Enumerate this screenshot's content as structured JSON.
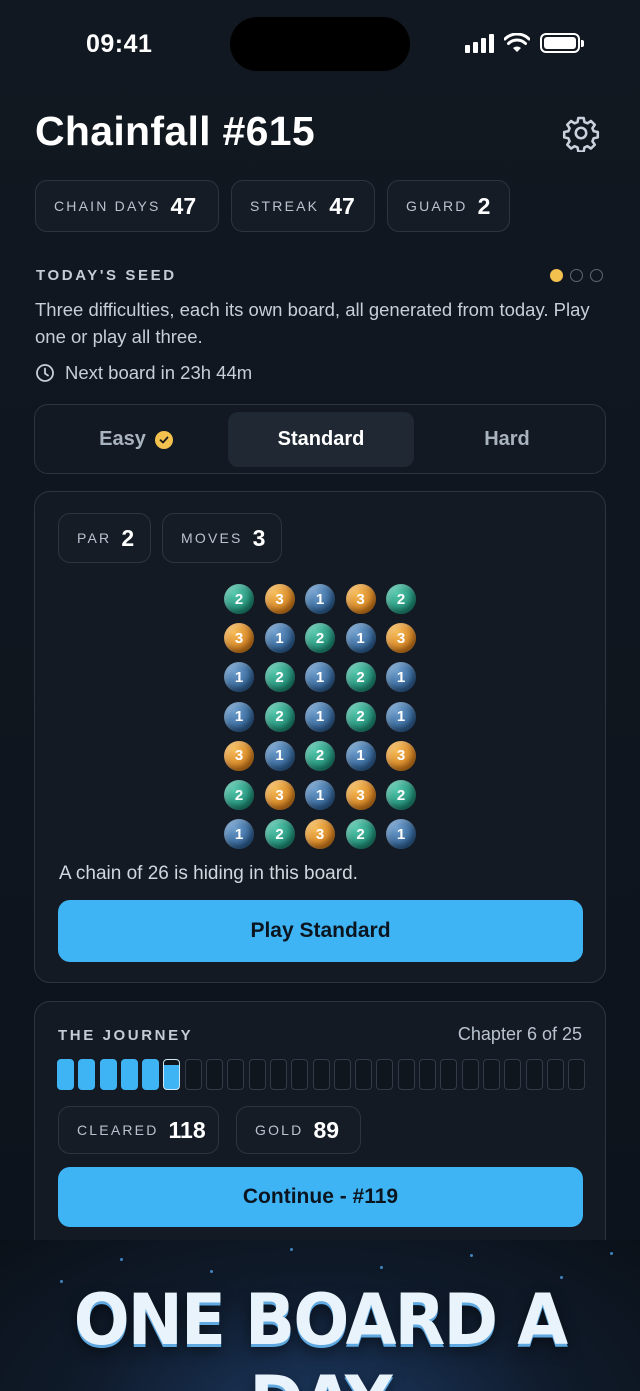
{
  "status_bar": {
    "time": "09:41"
  },
  "header": {
    "title": "Chainfall #615"
  },
  "stats": [
    {
      "label": "CHAIN DAYS",
      "value": "47"
    },
    {
      "label": "STREAK",
      "value": "47"
    },
    {
      "label": "GUARD",
      "value": "2"
    }
  ],
  "seed": {
    "label": "TODAY'S SEED",
    "description": "Three difficulties, each its own board, all generated from today. Play one or play all three.",
    "next_board": "Next board in 23h 44m",
    "page_dots": {
      "count": 3,
      "active": 0
    }
  },
  "tabs": [
    {
      "label": "Easy",
      "completed": true
    },
    {
      "label": "Standard",
      "selected": true
    },
    {
      "label": "Hard"
    }
  ],
  "board_card": {
    "par": {
      "label": "PAR",
      "value": "2"
    },
    "moves": {
      "label": "MOVES",
      "value": "3"
    },
    "grid": [
      [
        2,
        3,
        1,
        3,
        2
      ],
      [
        3,
        1,
        2,
        1,
        3
      ],
      [
        1,
        2,
        1,
        2,
        1
      ],
      [
        1,
        2,
        1,
        2,
        1
      ],
      [
        3,
        1,
        2,
        1,
        3
      ],
      [
        2,
        3,
        1,
        3,
        2
      ],
      [
        1,
        2,
        3,
        2,
        1
      ]
    ],
    "hint": "A chain of 26 is hiding in this board.",
    "play_label": "Play Standard"
  },
  "journey": {
    "label": "THE JOURNEY",
    "chapter": "Chapter 6 of 25",
    "segments_total": 25,
    "segments_completed": 5,
    "cleared": {
      "label": "CLEARED",
      "value": "118"
    },
    "gold": {
      "label": "GOLD",
      "value": "89"
    },
    "continue_label": "Continue - #119"
  },
  "promo": {
    "text": "ONE BOARD A DAY"
  },
  "colors": {
    "accent": "#3fb4f4",
    "gold": "#f2c14e",
    "ball_1": "#3f74a8",
    "ball_2": "#2aa68a",
    "ball_3": "#e8962e"
  }
}
